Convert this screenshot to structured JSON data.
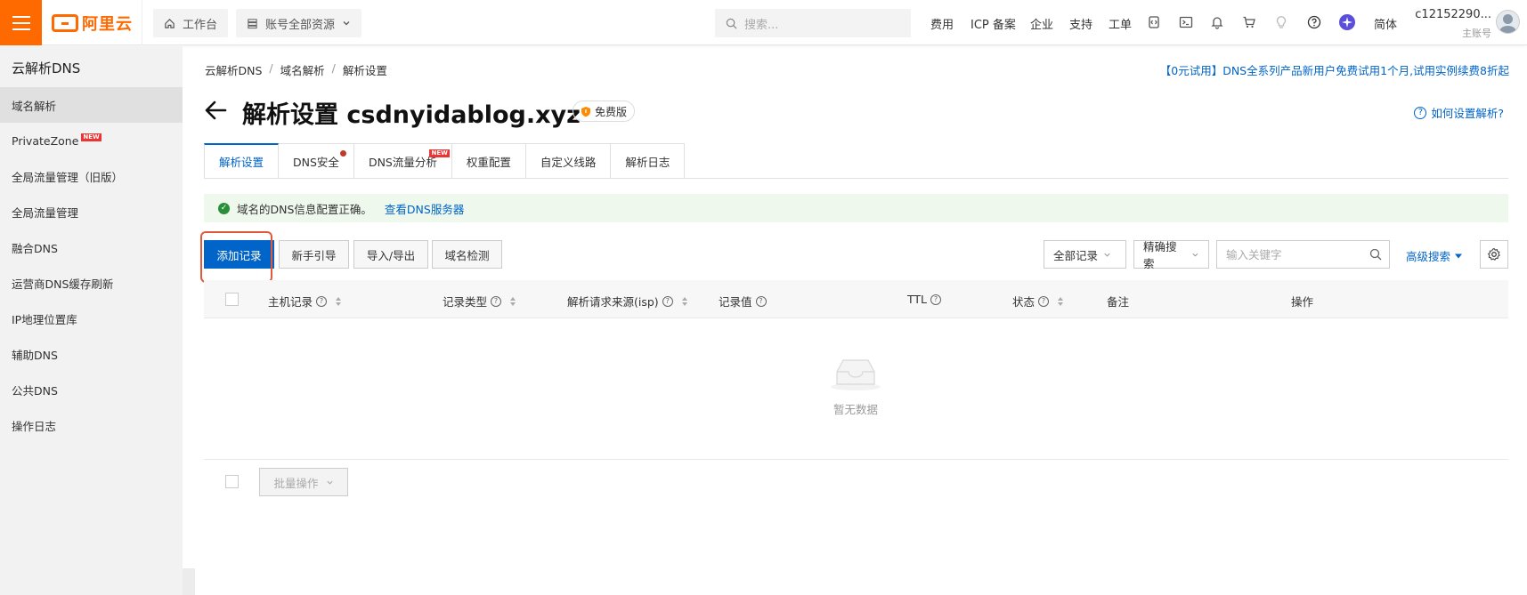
{
  "topbar": {
    "logo_text": "阿里云",
    "workbench_label": "工作台",
    "resources_label": "账号全部资源",
    "search_placeholder": "搜索...",
    "links": [
      "费用",
      "ICP 备案",
      "企业",
      "支持",
      "工单"
    ],
    "language": "简体",
    "user_id": "c12152290...",
    "user_role": "主账号",
    "brand_color": "#ff6a00"
  },
  "sidebar": {
    "title": "云解析DNS",
    "items": [
      {
        "label": "域名解析"
      },
      {
        "label": "PrivateZone",
        "tag": "NEW"
      },
      {
        "label": "全局流量管理（旧版）"
      },
      {
        "label": "全局流量管理"
      },
      {
        "label": "融合DNS"
      },
      {
        "label": "运营商DNS缓存刷新"
      },
      {
        "label": "IP地理位置库"
      },
      {
        "label": "辅助DNS"
      },
      {
        "label": "公共DNS"
      },
      {
        "label": "操作日志"
      }
    ]
  },
  "breadcrumb": [
    "云解析DNS",
    "域名解析",
    "解析设置"
  ],
  "promo": "【0元试用】DNS全系列产品新用户免费试用1个月,试用实例续费8折起",
  "page": {
    "title": "解析设置 csdnyidablog.xyz",
    "badge": "免费版",
    "help": "如何设置解析?"
  },
  "tabs": [
    {
      "label": "解析设置"
    },
    {
      "label": "DNS安全"
    },
    {
      "label": "DNS流量分析",
      "tag": "NEW"
    },
    {
      "label": "权重配置"
    },
    {
      "label": "自定义线路"
    },
    {
      "label": "解析日志"
    }
  ],
  "notice": {
    "text": "域名的DNS信息配置正确。",
    "link": "查看DNS服务器"
  },
  "toolbar": {
    "add_record": "添加记录",
    "guide": "新手引导",
    "import_export": "导入/导出",
    "domain_check": "域名检测",
    "filter_all": "全部记录",
    "search_mode": "精确搜索",
    "keyword_placeholder": "输入关键字",
    "advanced_search": "高级搜索"
  },
  "table": {
    "columns": [
      "主机记录",
      "记录类型",
      "解析请求来源(isp)",
      "记录值",
      "TTL",
      "状态",
      "备注",
      "操作"
    ],
    "empty_text": "暂无数据",
    "batch_label": "批量操作"
  },
  "accent_color": "#0064c8"
}
